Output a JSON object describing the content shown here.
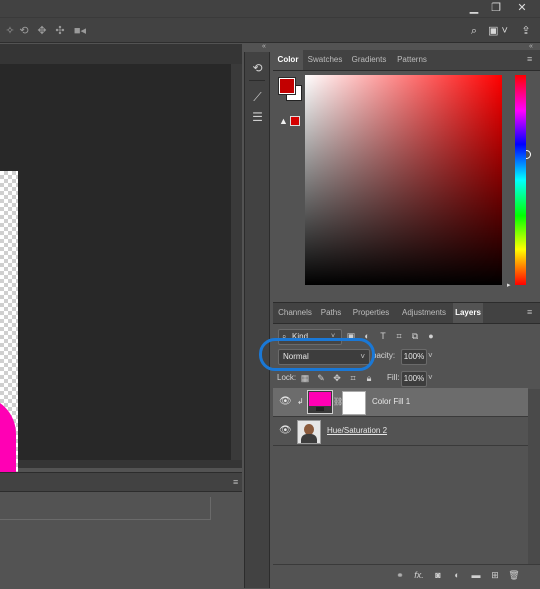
{
  "window": {
    "minimize_icon": "minimize-icon",
    "restore_icon": "restore-icon",
    "close_label": "✕"
  },
  "options_bar": {
    "icons": [
      "orbit-3d-icon",
      "roll-3d-icon",
      "pan-3d-icon",
      "slide-3d-icon",
      "video-camera-icon"
    ],
    "right_icons": [
      "search-icon",
      "workspace-icon",
      "share-icon"
    ]
  },
  "color_panel": {
    "tabs": [
      "Color",
      "Swatches",
      "Gradients",
      "Patterns"
    ],
    "active_tab": "Color",
    "foreground_color": "#c20000",
    "background_color": "#ffffff",
    "warning_icon": "gamut-warning-icon"
  },
  "layers_panel": {
    "tabs": [
      "Channels",
      "Paths",
      "Properties",
      "Adjustments",
      "Layers"
    ],
    "active_tab": "Layers",
    "filter_label": "Kind",
    "blend_mode": "Normal",
    "opacity_label": "pacity:",
    "opacity_value": "100%",
    "lock_label": "Lock:",
    "fill_label": "Fill:",
    "fill_value": "100%",
    "layers": [
      {
        "name": "Color Fill 1",
        "selected": true,
        "thumb_color": "#ff00b4",
        "visible": true
      },
      {
        "name": "Hue/Saturation 2",
        "selected": false,
        "visible": true
      }
    ],
    "bottom_icons": [
      "link-icon",
      "fx-icon",
      "mask-icon",
      "adjustment-icon",
      "folder-icon",
      "new-layer-icon",
      "trash-icon"
    ]
  },
  "canvas": {
    "shape_color": "#ff00b4"
  },
  "annotation": {
    "color": "#1a78d6"
  }
}
